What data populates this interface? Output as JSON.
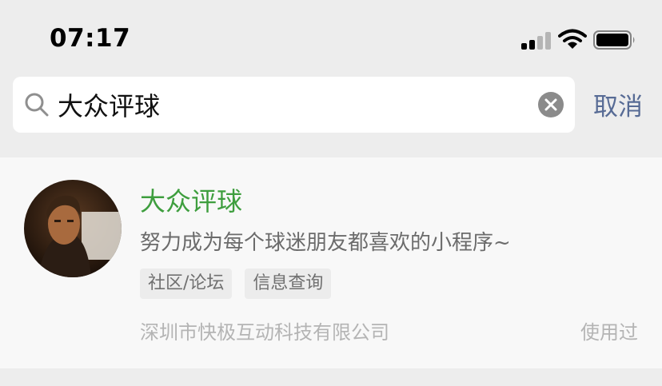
{
  "status_bar": {
    "time": "07:17",
    "signal_icon": "cellular-signal",
    "wifi_icon": "wifi",
    "battery_icon": "battery-full"
  },
  "search": {
    "icon": "search-icon",
    "value": "大众评球",
    "placeholder": "",
    "clear_icon": "clear-icon",
    "cancel_label": "取消"
  },
  "result": {
    "avatar": "avatar",
    "title": "大众评球",
    "description": "努力成为每个球迷朋友都喜欢的小程序~",
    "tags": [
      "社区/论坛",
      "信息查询"
    ],
    "company": "深圳市快极互动科技有限公司",
    "used_label": "使用过"
  },
  "colors": {
    "background": "#ededed",
    "card": "#f8f8f8",
    "title_green": "#3e9e3e",
    "cancel_blue": "#576b95",
    "muted_text": "#b4b4b4"
  }
}
